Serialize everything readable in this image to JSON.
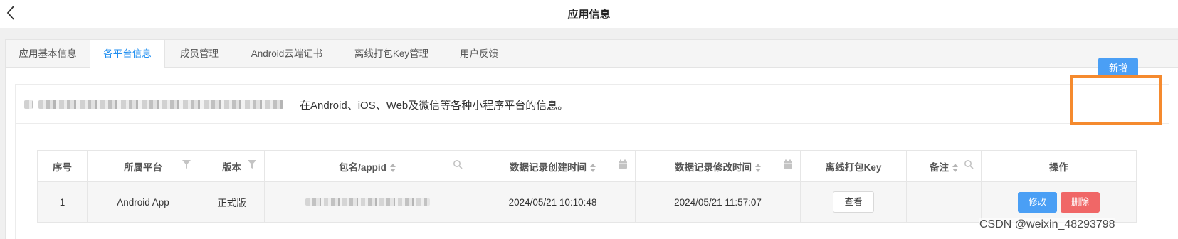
{
  "header": {
    "title": "应用信息"
  },
  "tabs": [
    {
      "label": "应用基本信息"
    },
    {
      "label": "各平台信息"
    },
    {
      "label": "成员管理"
    },
    {
      "label": "Android云端证书"
    },
    {
      "label": "离线打包Key管理"
    },
    {
      "label": "用户反馈"
    }
  ],
  "active_tab": "各平台信息",
  "description": "在Android、iOS、Web及微信等各种小程序平台的信息。",
  "add_button": "新增",
  "table": {
    "columns": [
      "序号",
      "所属平台",
      "版本",
      "包名/appid",
      "数据记录创建时间",
      "数据记录修改时间",
      "离线打包Key",
      "备注",
      "操作"
    ],
    "rows": [
      {
        "index": "1",
        "platform": "Android App",
        "version": "正式版",
        "created": "2024/05/21 10:10:48",
        "modified": "2024/05/21 11:57:07",
        "view_label": "查看",
        "note": "",
        "edit_label": "修改",
        "delete_label": "删除"
      }
    ]
  },
  "watermark": "CSDN @weixin_48293798",
  "colors": {
    "primary": "#4a9ff5",
    "danger": "#f06767",
    "highlight": "#f58a2e",
    "active_tab": "#1f8ef0"
  }
}
